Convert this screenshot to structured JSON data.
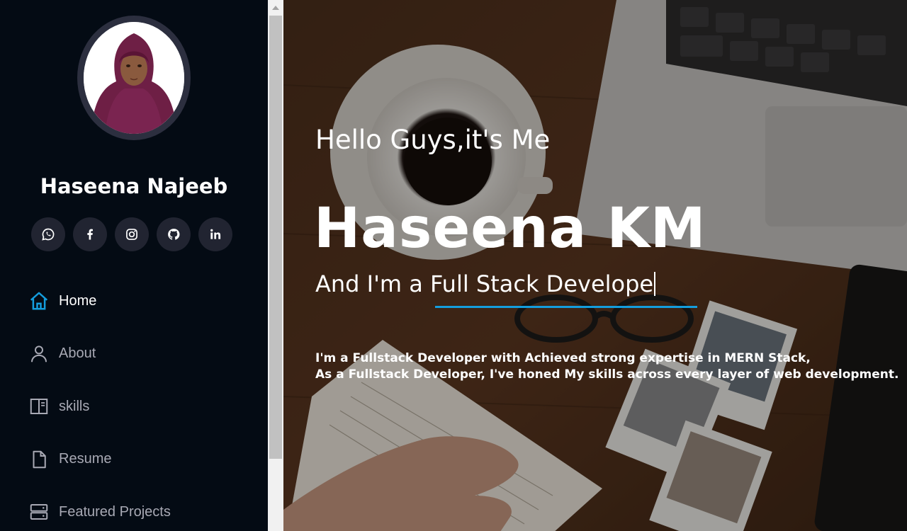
{
  "profile": {
    "name": "Haseena Najeeb"
  },
  "socials": [
    {
      "icon": "whatsapp-icon"
    },
    {
      "icon": "facebook-icon"
    },
    {
      "icon": "instagram-icon"
    },
    {
      "icon": "github-icon"
    },
    {
      "icon": "linkedin-icon"
    }
  ],
  "nav": {
    "items": [
      {
        "label": "Home",
        "icon": "home-icon",
        "active": true
      },
      {
        "label": "About",
        "icon": "person-icon",
        "active": false
      },
      {
        "label": "skills",
        "icon": "layout-icon",
        "active": false
      },
      {
        "label": "Resume",
        "icon": "file-icon",
        "active": false
      },
      {
        "label": "Featured Projects",
        "icon": "server-icon",
        "active": false
      }
    ]
  },
  "hero": {
    "greeting": "Hello Guys,it's Me",
    "name": "Haseena KM",
    "role": "And I'm a Full Stack Develope",
    "description": [
      "I'm a Fullstack Developer with Achieved strong expertise in MERN Stack,",
      "As a Fullstack Developer, I've honed My skills across every layer of web development."
    ]
  },
  "colors": {
    "sidebar_bg": "#040b14",
    "accent": "#149ddd",
    "social_bg": "#212431",
    "nav_text": "#a8a9b4"
  }
}
